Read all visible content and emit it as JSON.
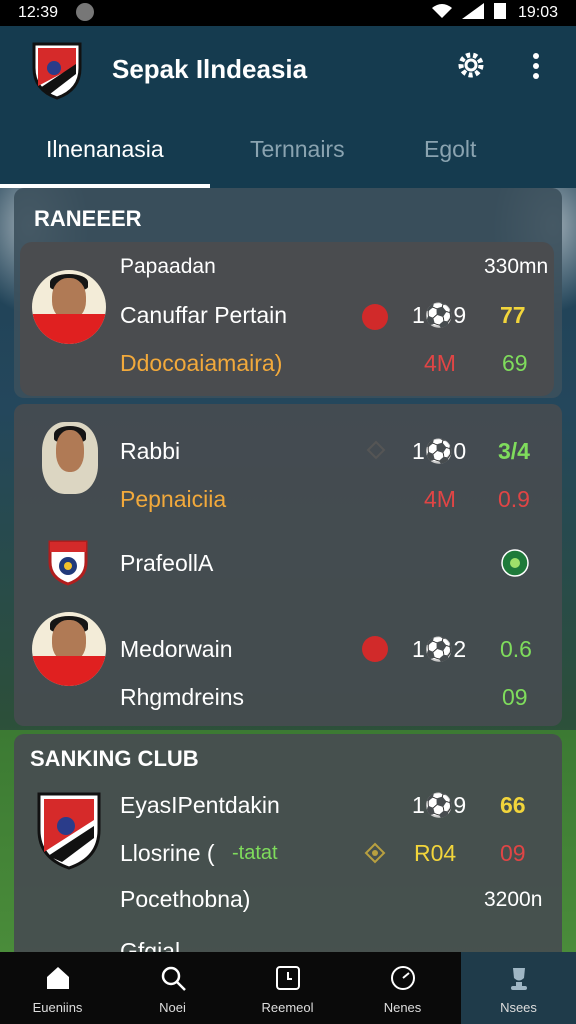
{
  "status_bar": {
    "time_left": "12:39",
    "time_right": "19:03"
  },
  "app": {
    "title": "Sepak Ilndeasia"
  },
  "tabs": [
    "Ilnenanasia",
    "Ternnairs",
    "Egolt"
  ],
  "section_a": {
    "title": "RANEEER",
    "card": {
      "row1_left": "Papaadan",
      "row1_right": "330mn",
      "name": "Canuffar Pertain",
      "score": "1⚽9",
      "points": "77",
      "sub": "Ddocoaiamaira)",
      "sub_val": "4M",
      "sub_val2": "69"
    }
  },
  "section_b": {
    "player1": {
      "name": "Rabbi",
      "score": "1⚽0",
      "points": "3/4",
      "sub": "Pepnaiciia",
      "sub_val": "4M",
      "sub_val2": "0.9"
    },
    "club": {
      "name": "PrafeollA"
    },
    "player2": {
      "name": "Medorwain",
      "score": "1⚽2",
      "points": "0.6",
      "sub": "Rhgmdreins",
      "sub_val2": "09"
    }
  },
  "section_c": {
    "title": "SANKING CLUB",
    "row1": {
      "name": "EyasIPentdakin",
      "score": "1⚽9",
      "points": "66"
    },
    "row2": {
      "name": "Llosrine (",
      "tag": "-tatat",
      "score": "R04",
      "points": "09"
    },
    "row3": {
      "name": "Pocethobna)",
      "value": "3200n"
    },
    "row4": {
      "name": "Gfgial"
    }
  },
  "nav": [
    "Eueniins",
    "Noei",
    "Reemeol",
    "Nenes",
    "Nsees"
  ],
  "colors": {
    "accent": "#153b4f",
    "orange": "#f2a93b",
    "red": "#e04545",
    "green": "#7fdc5c",
    "yellow": "#f2d53b"
  }
}
